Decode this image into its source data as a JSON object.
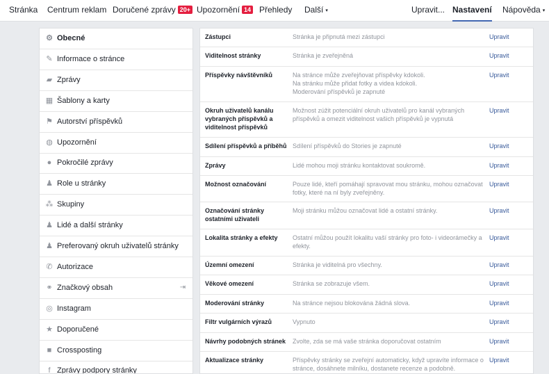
{
  "nav": {
    "items": [
      {
        "label": "Stránka"
      },
      {
        "label": "Centrum reklam"
      },
      {
        "label": "Doručené zprávy",
        "badge": "20+"
      },
      {
        "label": "Upozornění",
        "badge": "14"
      },
      {
        "label": "Přehledy"
      },
      {
        "label": "Další",
        "caret": "▾"
      },
      {
        "label": "Upravit..."
      },
      {
        "label": "Nastavení"
      },
      {
        "label": "Nápověda",
        "caret": "▾"
      }
    ]
  },
  "sidebar": {
    "items": [
      {
        "label": "Obecné",
        "icon": "gear-icon",
        "glyph": "⚙"
      },
      {
        "label": "Informace o stránce",
        "icon": "pencil-icon",
        "glyph": "✎"
      },
      {
        "label": "Zprávy",
        "icon": "messages-icon",
        "glyph": "▰"
      },
      {
        "label": "Šablony a karty",
        "icon": "grid-icon",
        "glyph": "▦"
      },
      {
        "label": "Autorství příspěvků",
        "icon": "flag-icon",
        "glyph": "⚑"
      },
      {
        "label": "Upozornění",
        "icon": "globe-icon",
        "glyph": "◍"
      },
      {
        "label": "Pokročilé zprávy",
        "icon": "chat-bubble-icon",
        "glyph": "●"
      },
      {
        "label": "Role u stránky",
        "icon": "person-icon",
        "glyph": "♟"
      },
      {
        "label": "Skupiny",
        "icon": "group-icon",
        "glyph": "⁂"
      },
      {
        "label": "Lidé a další stránky",
        "icon": "person-star-icon",
        "glyph": "♟"
      },
      {
        "label": "Preferovaný okruh uživatelů stránky",
        "icon": "person-star-icon",
        "glyph": "♟"
      },
      {
        "label": "Autorizace",
        "icon": "wrench-icon",
        "glyph": "✆"
      },
      {
        "label": "Značkový obsah",
        "icon": "handshake-icon",
        "glyph": "⚭"
      },
      {
        "label": "Instagram",
        "icon": "instagram-icon",
        "glyph": "◎"
      },
      {
        "label": "Doporučené",
        "icon": "star-icon",
        "glyph": "★"
      },
      {
        "label": "Crossposting",
        "icon": "video-camera-icon",
        "glyph": "■"
      },
      {
        "label": "Zprávy podpory stránky",
        "icon": "facebook-icon",
        "glyph": "f"
      }
    ],
    "branded_extra_icon": "external-link-icon",
    "branded_extra_glyph": "⇥"
  },
  "settings": {
    "edit_label": "Upravit",
    "rows": [
      {
        "label": "Zástupci",
        "value": [
          "Stránka je připnutá mezi zástupci"
        ]
      },
      {
        "label": "Viditelnost stránky",
        "value": [
          "Stránka je zveřejněná"
        ]
      },
      {
        "label": "Příspěvky návštěvníků",
        "value": [
          "Na stránce může zveřejňovat příspěvky kdokoli.",
          "Na stránku může přidat fotky a videa kdokoli.",
          "Moderování příspěvků je zapnuté"
        ]
      },
      {
        "label": "Okruh uživatelů kanálu vybraných příspěvků a viditelnost příspěvků",
        "value": [
          "Možnost zúžit potenciální okruh uživatelů pro kanál vybraných příspěvků a omezit viditelnost vašich příspěvků je vypnutá"
        ]
      },
      {
        "label": "Sdílení příspěvků a příběhů",
        "value": [
          "Sdílení příspěvků do Stories je zapnuté"
        ]
      },
      {
        "label": "Zprávy",
        "value": [
          "Lidé mohou moji stránku kontaktovat soukromě."
        ]
      },
      {
        "label": "Možnost označování",
        "value": [
          "Pouze lidé, kteří pomáhají spravovat mou stránku, mohou označovat fotky, které na ní byly zveřejněny."
        ]
      },
      {
        "label": "Označování stránky ostatními uživateli",
        "value": [
          "Moji stránku můžou označovat lidé a ostatní stránky."
        ]
      },
      {
        "label": "Lokalita stránky a efekty",
        "value": [
          "Ostatní můžou použít lokalitu vaší stránky pro foto- i videorámečky a efekty."
        ]
      },
      {
        "label": "Územní omezení",
        "value": [
          "Stránka je viditelná pro všechny."
        ]
      },
      {
        "label": "Věkové omezení",
        "value": [
          "Stránka se zobrazuje všem."
        ]
      },
      {
        "label": "Moderování stránky",
        "value": [
          "Na stránce nejsou blokována žádná slova."
        ]
      },
      {
        "label": "Filtr vulgárních výrazů",
        "value": [
          "Vypnuto"
        ]
      },
      {
        "label": "Návrhy podobných stránek",
        "value": [
          "Zvolte, zda se má vaše stránka doporučovat ostatním"
        ]
      },
      {
        "label": "Aktualizace stránky",
        "value": [
          "Příspěvky stránky se zveřejní automaticky, když upravíte informace o stránce, dosáhnete milníku, dostanete recenze a podobně."
        ]
      }
    ]
  }
}
